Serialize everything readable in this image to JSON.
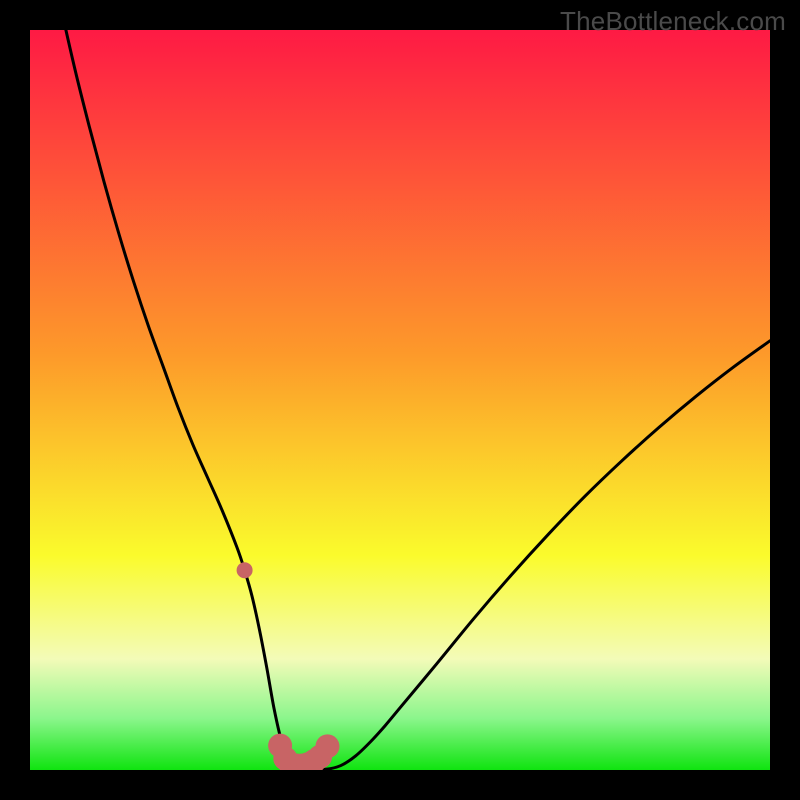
{
  "watermark": "TheBottleneck.com",
  "colors": {
    "bg_black": "#000000",
    "grad_red": "#fe1a44",
    "grad_orange": "#fd9a2a",
    "grad_yellow": "#fafb2c",
    "grad_pale": "#f3fbb8",
    "grad_green_light": "#8bf68c",
    "grad_green": "#0fe40f",
    "curve": "#000000",
    "markers": "#c86465"
  },
  "chart_data": {
    "type": "line",
    "title": "",
    "xlabel": "",
    "ylabel": "",
    "xlim": [
      0,
      100
    ],
    "ylim": [
      0,
      100
    ],
    "x": [
      0,
      2,
      4,
      6,
      8,
      10,
      12,
      14,
      16,
      18,
      20,
      22,
      24,
      26,
      28,
      29,
      30,
      31,
      32,
      33,
      34,
      35,
      36,
      38,
      40,
      42,
      44,
      46,
      48,
      50,
      55,
      60,
      65,
      70,
      75,
      80,
      85,
      90,
      95,
      100
    ],
    "values": [
      125,
      115,
      104,
      95,
      87,
      79.5,
      72.5,
      66,
      60,
      54.5,
      49,
      44,
      39.5,
      35,
      30,
      27,
      23.5,
      19,
      13.8,
      8.2,
      3.9,
      1.6,
      0.6,
      0.15,
      0.1,
      0.6,
      1.9,
      3.8,
      6,
      8.4,
      14.4,
      20.5,
      26.3,
      31.8,
      37,
      41.8,
      46.3,
      50.5,
      54.4,
      58
    ],
    "markers": {
      "x": [
        29,
        33.8,
        34.5,
        35.2,
        36,
        36.8,
        37.6,
        38.4,
        39.2,
        40.2
      ],
      "y": [
        27,
        3.3,
        1.55,
        0.8,
        0.6,
        0.6,
        0.8,
        1.2,
        1.8,
        3.2
      ]
    },
    "gradient_stops": [
      {
        "pos": 0,
        "color_key": "grad_red"
      },
      {
        "pos": 44,
        "color_key": "grad_orange"
      },
      {
        "pos": 71,
        "color_key": "grad_yellow"
      },
      {
        "pos": 85,
        "color_key": "grad_pale"
      },
      {
        "pos": 93,
        "color_key": "grad_green_light"
      },
      {
        "pos": 100,
        "color_key": "grad_green"
      }
    ]
  }
}
